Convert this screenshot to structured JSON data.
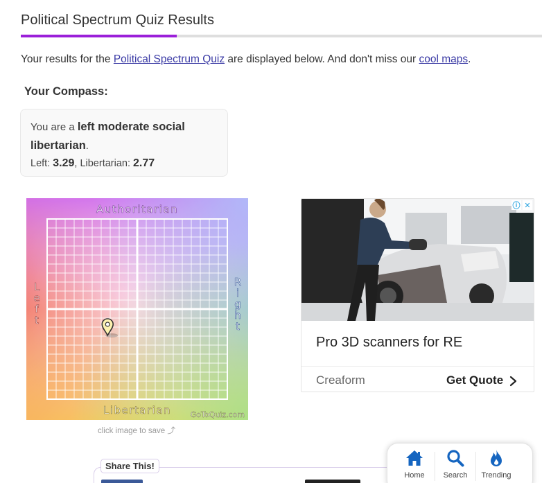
{
  "header": {
    "title": "Political Spectrum Quiz Results"
  },
  "intro": {
    "prefix": "Your results for the ",
    "quiz_link": "Political Spectrum Quiz",
    "middle": " are displayed below. And don't miss our ",
    "maps_link": "cool maps",
    "suffix": "."
  },
  "compass": {
    "heading": "Your Compass:",
    "result_prefix": "You are a ",
    "result_label": "left moderate social libertarian",
    "result_suffix": ".",
    "left_label": "Left: ",
    "left_value": "3.29",
    "separator": ", ",
    "lib_label": "Libertarian: ",
    "lib_value": "2.77",
    "chart": {
      "top_label": "Authoritarian",
      "bottom_label": "Libertarian",
      "left_label": "Left",
      "right_label": "Right",
      "watermark": "GoToQuiz.com",
      "marker_x": -3.29,
      "marker_y": -2.77
    },
    "caption": "click image to save ⤴"
  },
  "ad": {
    "choices_icon": "info-icon",
    "close_icon": "close-icon",
    "headline": "Pro 3D scanners for RE",
    "advertiser": "Creaform",
    "cta": "Get Quote"
  },
  "share": {
    "label": "Share This!"
  },
  "bottom_nav": {
    "items": [
      {
        "label": "Home",
        "icon": "home-icon"
      },
      {
        "label": "Search",
        "icon": "search-icon"
      },
      {
        "label": "Trending",
        "icon": "flame-icon"
      }
    ],
    "color": "#1565c0"
  },
  "colors": {
    "accent": "#9b1fd9",
    "link": "#3a3aa5"
  }
}
